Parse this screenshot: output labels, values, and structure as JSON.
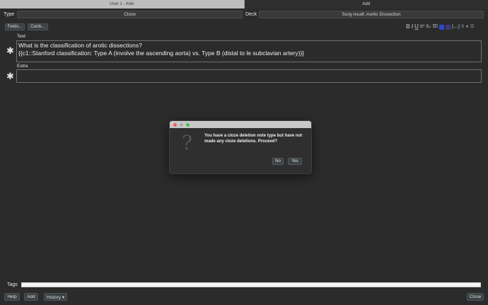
{
  "tabs": [
    {
      "label": "User 1 - Anki"
    },
    {
      "label": "Add"
    }
  ],
  "type_label": "Type",
  "type_value": "Cloze",
  "deck_label": "Deck",
  "deck_value": "Surg recall::Aortic Dissection",
  "fields_button": "Fields...",
  "cards_button": "Cards...",
  "toolbar": {
    "bold": "B",
    "italic": "I",
    "underline": "U",
    "superscript": "S²",
    "subscript": "S₂",
    "text_color": "#2f49d1",
    "highlight_color": "#3b3b7a"
  },
  "fields": [
    {
      "label": "Text",
      "line1": "What is the classification of arotic dissections?",
      "line2": "{{c1::Stanford classification: Type A (involve the ascending aorta) vs. Type B (distal to le subclavian artery)}}"
    },
    {
      "label": "Extra",
      "line1": ""
    }
  ],
  "star": "✱",
  "dialog": {
    "question_mark": "?",
    "message": "You have a cloze deletion note type but have not made any cloze deletions. Proceed?",
    "no_button": "No",
    "yes_button": "Yes"
  },
  "tags_label": "Tags",
  "bottom": {
    "help": "Help",
    "add": "Add",
    "history": "History ▾",
    "close": "Close"
  }
}
